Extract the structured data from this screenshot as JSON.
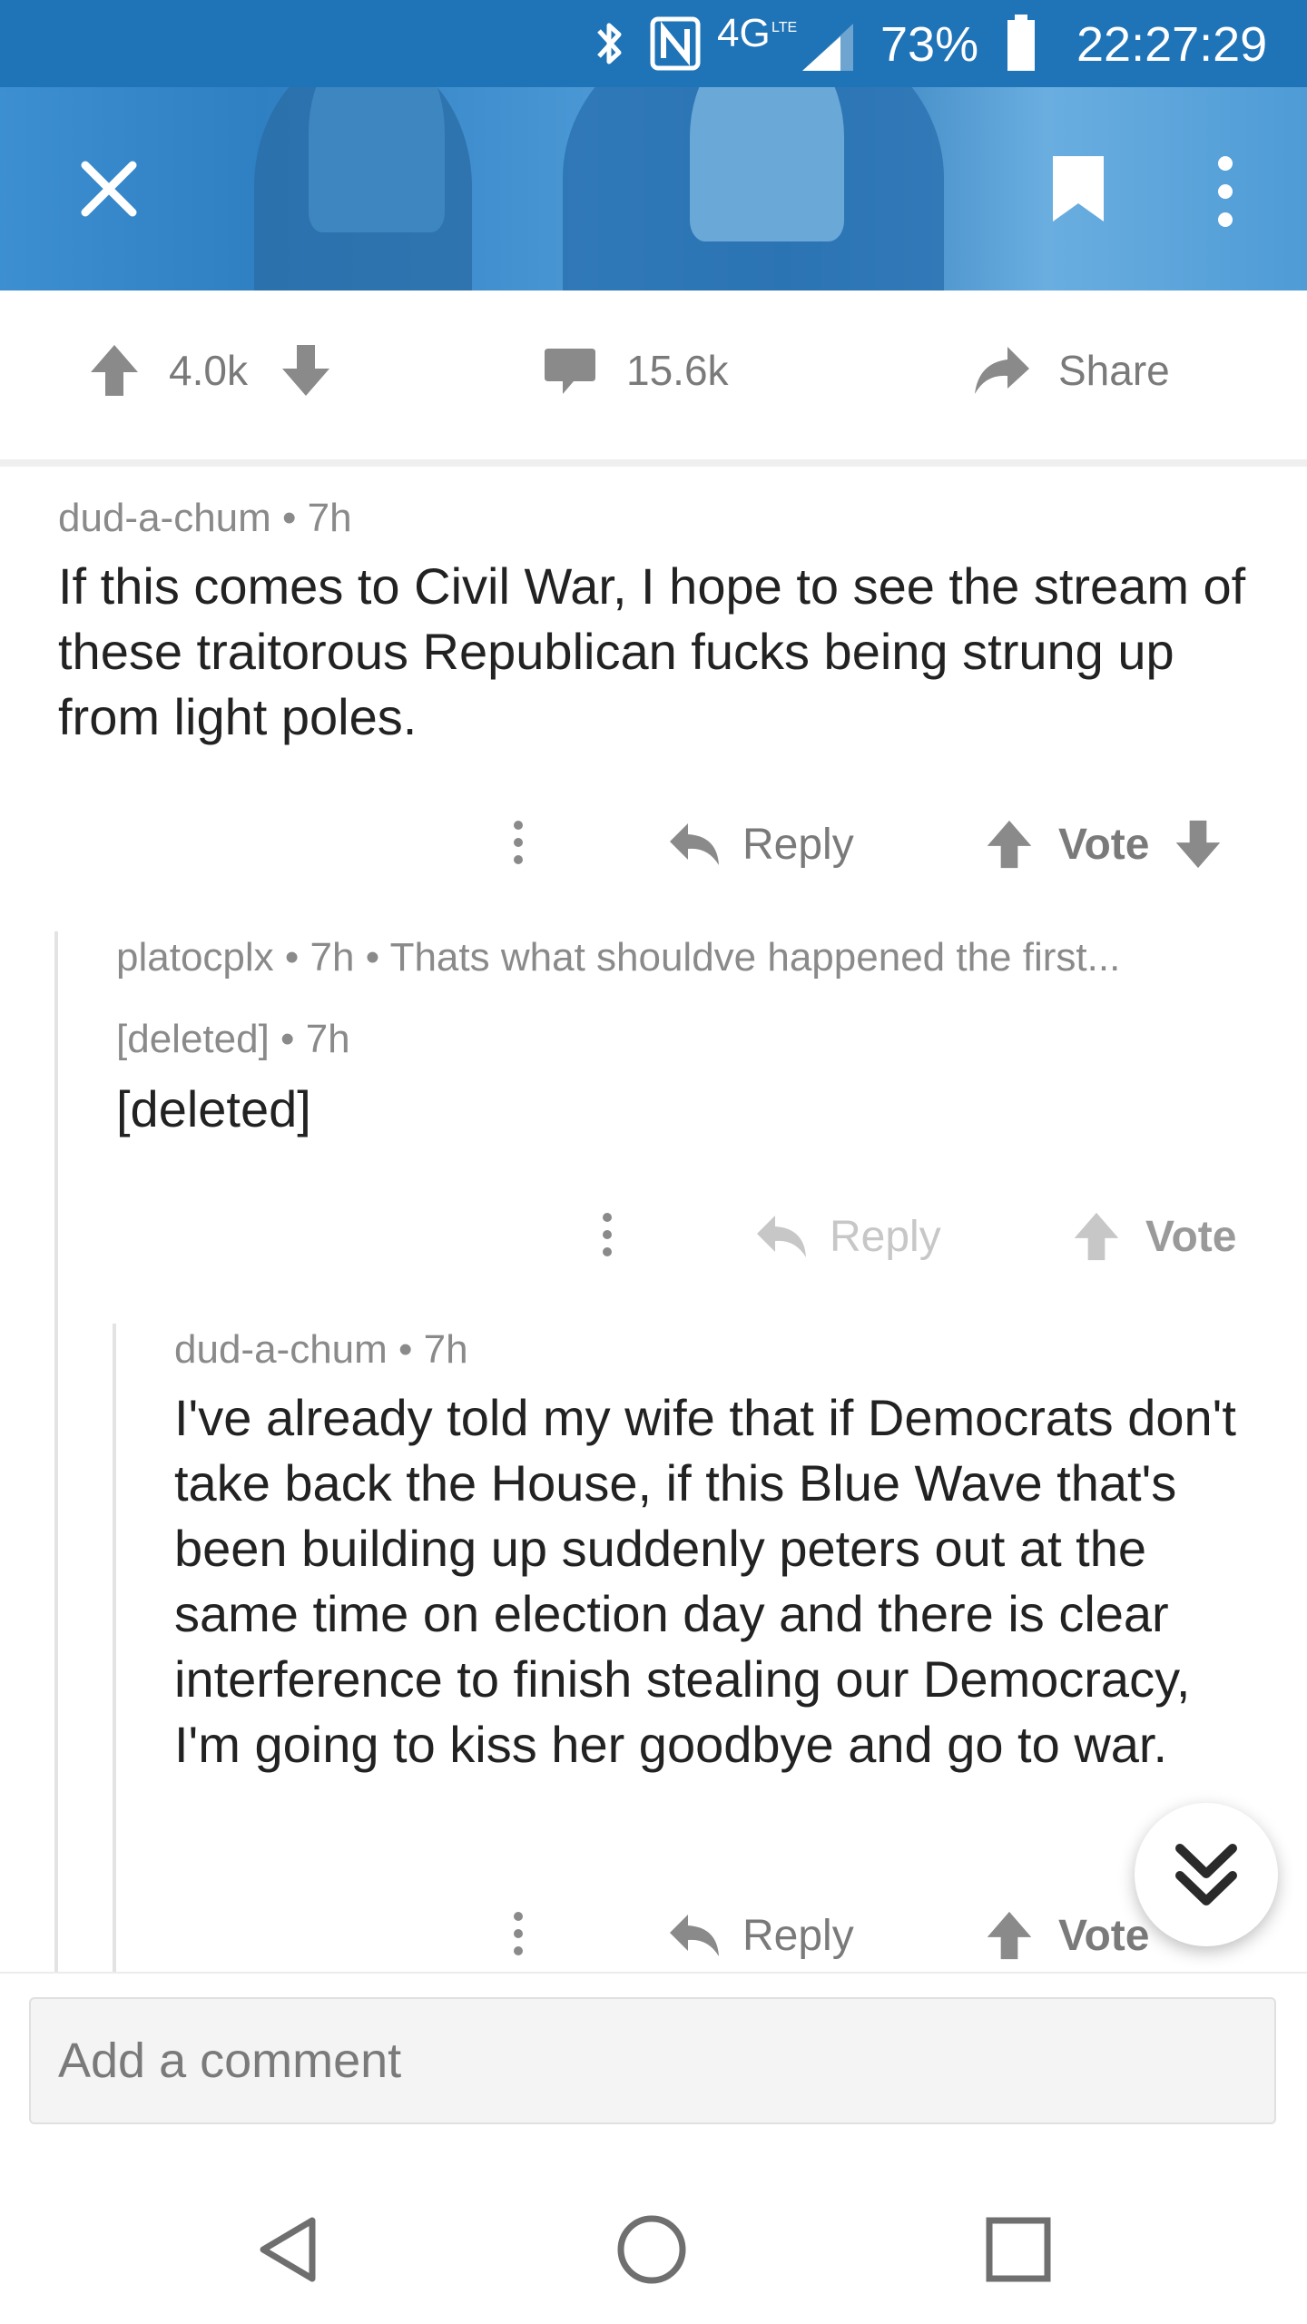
{
  "status_bar": {
    "network": "4G",
    "network_sub": "LTE",
    "battery": "73%",
    "time": "22:27:29"
  },
  "header": {
    "close_icon": "close-icon",
    "bookmark_icon": "bookmark-icon",
    "more_icon": "more-vertical-icon"
  },
  "post_actions": {
    "upvotes": "4.0k",
    "comments": "15.6k",
    "share_label": "Share"
  },
  "comments": [
    {
      "author": "dud-a-chum",
      "age": "7h",
      "body": "If this comes to Civil War, I hope to see the stream of these traitorous Republican fucks being strung up from light poles.",
      "reply_label": "Reply",
      "vote_label": "Vote"
    },
    {
      "author": "platocplx",
      "age": "7h",
      "preview": "Thats what shouldve happened the first..."
    },
    {
      "author": "[deleted]",
      "age": "7h",
      "body": "[deleted]",
      "reply_label": "Reply",
      "vote_label": "Vote"
    },
    {
      "author": "dud-a-chum",
      "age": "7h",
      "body": "I've already told my wife that if Democrats don't take back the House, if this Blue Wave that's been building up suddenly peters out at the same time on election day and there is clear interference to finish stealing our Democracy, I'm going to kiss her goodbye and go to war.",
      "reply_label": "Reply",
      "vote_label": "Vote"
    }
  ],
  "composer": {
    "placeholder": "Add a comment"
  },
  "colors": {
    "status_bar": "#1f73b7",
    "header_tint": "#3c8fd0",
    "meta_text": "#8a8a8a"
  }
}
